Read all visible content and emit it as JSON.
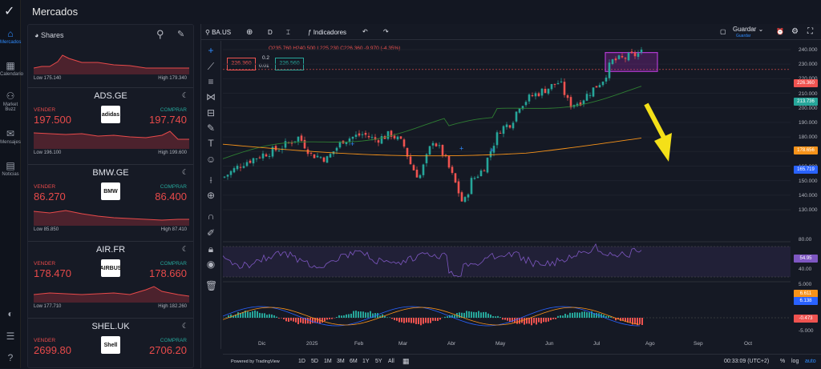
{
  "nav": [
    {
      "label": "Mercados",
      "icon": "home-icon",
      "glyph": "⌂",
      "active": true
    },
    {
      "label": "Calendario",
      "icon": "calendar-icon",
      "glyph": "▦",
      "active": false
    },
    {
      "label": "Market Buzz",
      "icon": "buzz-icon",
      "glyph": "⚇",
      "active": false
    },
    {
      "label": "Mensajes",
      "icon": "mail-icon",
      "glyph": "✉",
      "active": false
    },
    {
      "label": "Noticias",
      "icon": "news-icon",
      "glyph": "▤",
      "active": false
    }
  ],
  "panel": {
    "title": "Mercados",
    "tab": "Shares",
    "first_card": {
      "low": "Low 175.140",
      "high": "High 179.340"
    },
    "cards": [
      {
        "symbol": "ADS.GE",
        "sell_label": "VENDER",
        "sell": "197.500",
        "buy_label": "COMPRAR",
        "buy": "197.740",
        "logo": "adidas",
        "low": "Low 196.100",
        "high": "High 199.600"
      },
      {
        "symbol": "BMW.GE",
        "sell_label": "VENDER",
        "sell": "86.270",
        "buy_label": "COMPRAR",
        "buy": "86.400",
        "logo": "BMW",
        "low": "Low 85.850",
        "high": "High 87.410"
      },
      {
        "symbol": "AIR.FR",
        "sell_label": "VENDER",
        "sell": "178.470",
        "buy_label": "COMPRAR",
        "buy": "178.660",
        "logo": "AIRBUS",
        "low": "Low 177.710",
        "high": "High 182.260"
      },
      {
        "symbol": "SHEL.UK",
        "sell_label": "VENDER",
        "sell": "2699.80",
        "buy_label": "COMPRAR",
        "buy": "2706.20",
        "logo": "Shell",
        "low": "",
        "high": ""
      }
    ]
  },
  "chart": {
    "symbol": "BA.US",
    "interval": "D",
    "indicators_label": "Indicadores",
    "save_label": "Guardar",
    "save_sub": "Guardar",
    "ohlc": "O235.760 H240.500 L225.230 C226.360 -9.970 (-4.35%)",
    "sell_box": "226.360",
    "spread_top": "0.2",
    "spread_bottom": "0.01",
    "buy_box": "226.560",
    "price_labels": [
      "240.000",
      "230.000",
      "220.000",
      "210.000",
      "200.000",
      "190.000",
      "180.000",
      "170.000",
      "160.000",
      "150.000",
      "140.000",
      "130.000"
    ],
    "badges": {
      "last": "226.360",
      "ma_fast": "213.736",
      "ma_slow": "178.656",
      "ma_blue": "165.719",
      "rsi": "54.95",
      "macd1": "6.611",
      "macd2": "6.138",
      "macd3": "-0.473"
    },
    "rsi_labels": [
      "80.00",
      "40.00"
    ],
    "macd_labels": [
      "5.000",
      "-5.000"
    ],
    "months": [
      "Dic",
      "2025",
      "Feb",
      "Mar",
      "Abr",
      "May",
      "Jun",
      "Jul",
      "Ago",
      "Sep",
      "Oct"
    ],
    "ranges": [
      "1D",
      "5D",
      "1M",
      "3M",
      "6M",
      "1Y",
      "5Y",
      "All"
    ],
    "powered": "Powered by TradingView",
    "clock": "00:33:09 (UTC+2)",
    "pct": "%",
    "log": "log",
    "auto": "auto"
  },
  "colors": {
    "up": "#26a69a",
    "down": "#ef5350",
    "accent": "#2f8cff",
    "annotation": "#f4e018",
    "highlight": "#9c27b0"
  }
}
